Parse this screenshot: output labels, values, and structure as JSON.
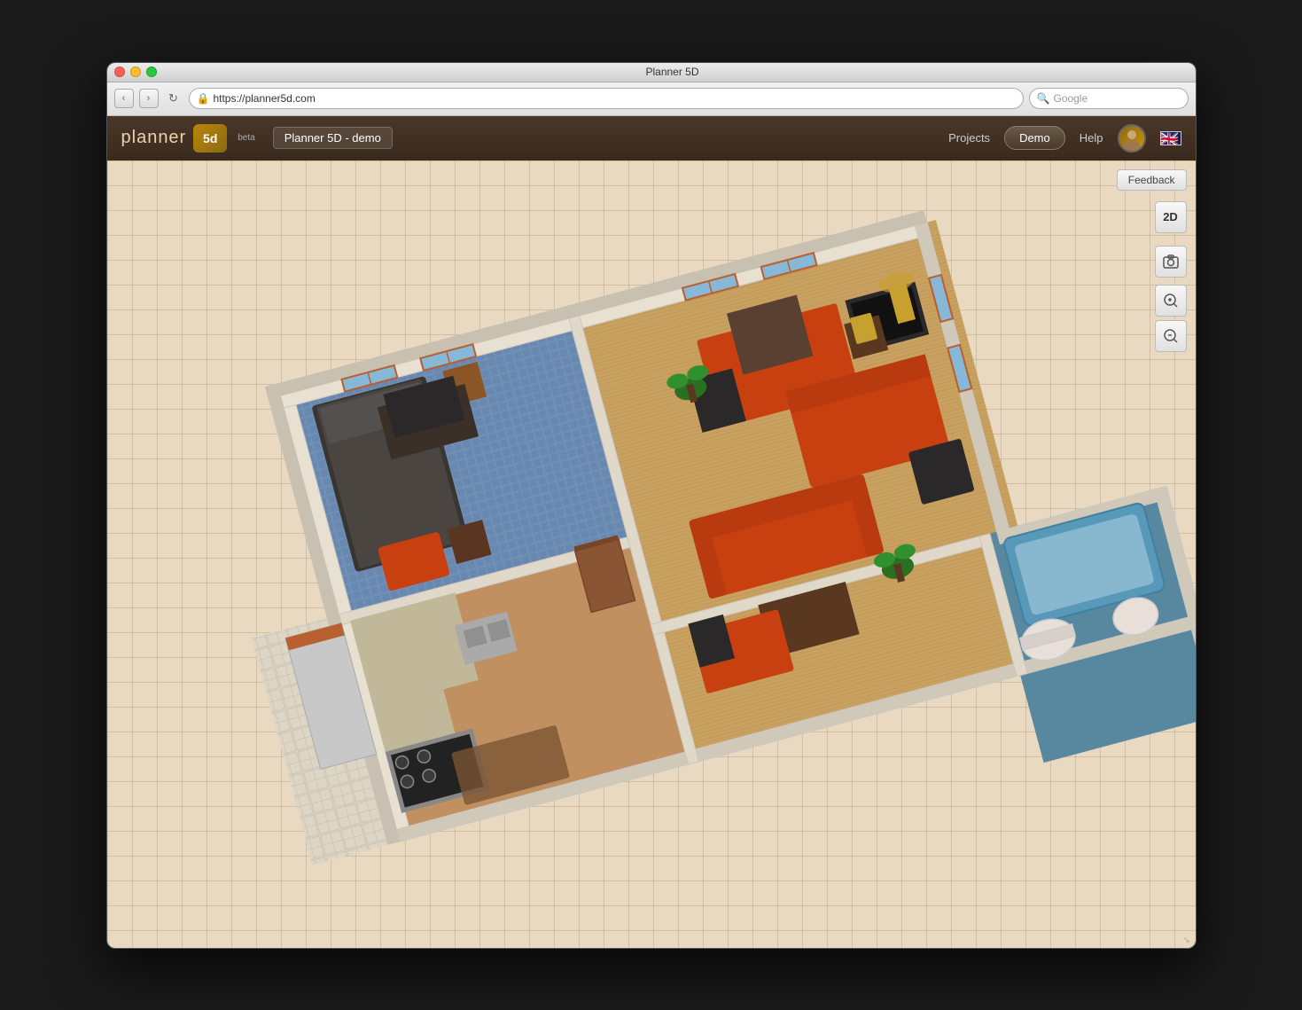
{
  "window": {
    "title": "Planner 5D",
    "traffic_lights": [
      "red",
      "yellow",
      "green"
    ]
  },
  "browser": {
    "back_label": "‹",
    "forward_label": "›",
    "refresh_label": "↻",
    "url": "https://planner5d.com",
    "lock_icon": "🔒",
    "search_placeholder": "Google",
    "search_icon": "🔍"
  },
  "app_header": {
    "logo_text": "planner",
    "logo_5d": "5d",
    "beta_label": "beta",
    "project_name": "Planner 5D - demo",
    "nav_items": [
      "Projects",
      "Demo",
      "Help"
    ],
    "demo_btn_label": "Demo"
  },
  "toolbar": {
    "feedback_label": "Feedback",
    "view_2d_label": "2D",
    "screenshot_icon": "📷",
    "zoom_in_label": "+",
    "zoom_out_label": "-"
  },
  "floorplan": {
    "description": "3D isometric floor plan with multiple rooms",
    "rooms": [
      {
        "name": "bedroom",
        "color": "#6b90b5"
      },
      {
        "name": "kitchen",
        "color": "#d4c9b0"
      },
      {
        "name": "living_room",
        "color": "#b8a080"
      },
      {
        "name": "office",
        "color": "#8b7355"
      },
      {
        "name": "bathroom",
        "color": "#5b8faa"
      }
    ],
    "wall_color": "#f5f0e8",
    "floor_wood_color": "#c8a878",
    "floor_tile_color": "#d8d0c0",
    "accent_color": "#b84c00"
  }
}
